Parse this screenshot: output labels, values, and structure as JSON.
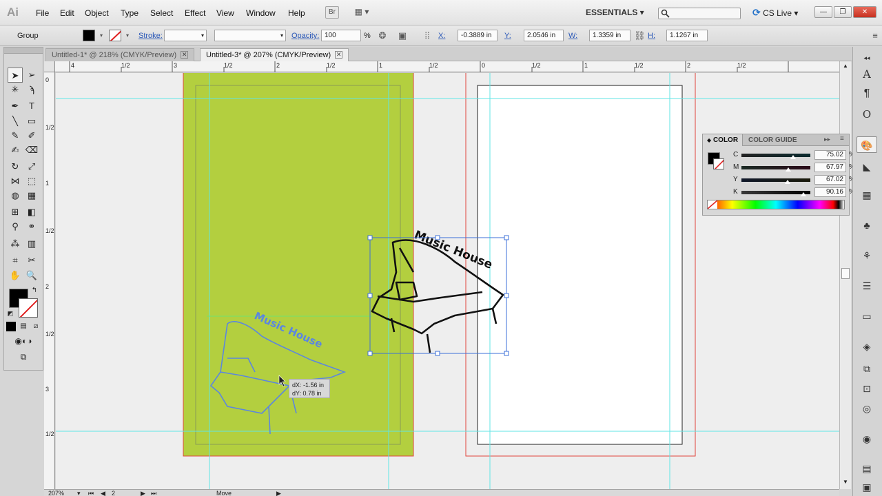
{
  "app": {
    "logo": "Ai"
  },
  "menu": [
    "File",
    "Edit",
    "Object",
    "Type",
    "Select",
    "Effect",
    "View",
    "Window",
    "Help"
  ],
  "menubar": {
    "bridge_label": "Br",
    "arrange_label": "▦ ▾",
    "workspace": "ESSENTIALS ▾",
    "search_placeholder": "",
    "cslive": "CS Live ▾",
    "win_min": "—",
    "win_max": "❐",
    "win_close": "✕"
  },
  "control": {
    "selection_type": "Group",
    "stroke_label": "Stroke:",
    "opacity_label": "Opacity:",
    "opacity_value": "100",
    "opacity_unit": "%",
    "x_label": "X:",
    "x_value": "-0.3889 in",
    "y_label": "Y:",
    "y_value": "2.0546 in",
    "w_label": "W:",
    "w_value": "1.3359 in",
    "h_label": "H:",
    "h_value": "1.1267 in"
  },
  "tabs": [
    {
      "label": "Untitled-1* @ 218% (CMYK/Preview)",
      "active": false
    },
    {
      "label": "Untitled-3* @ 207% (CMYK/Preview)",
      "active": true
    }
  ],
  "ruler_top": [
    "4",
    "1/2",
    "3",
    "1/2",
    "2",
    "1/2",
    "1",
    "1/2",
    "0",
    "1/2",
    "1",
    "1/2",
    "2",
    "1/2"
  ],
  "ruler_left": [
    "0",
    "1/2",
    "1",
    "1/2",
    "2",
    "1/2",
    "3",
    "1/2"
  ],
  "artwork": {
    "logo_text": "Music House",
    "move_tooltip": {
      "dx": "dX: -1.56 in",
      "dy": "dY: 0.78 in"
    },
    "colors": {
      "artboard_fill": "#b3cf3f",
      "bleed_red": "#e0443c",
      "guide_cyan": "#5fe6e6",
      "selection_blue": "#3b6fd8",
      "ghost_blue": "#5b86e0"
    }
  },
  "color_panel": {
    "tab_color": "COLOR",
    "tab_guide": "COLOR GUIDE",
    "channels": [
      {
        "letter": "C",
        "value": "75.02",
        "unit": "%"
      },
      {
        "letter": "M",
        "value": "67.97",
        "unit": "%"
      },
      {
        "letter": "Y",
        "value": "67.02",
        "unit": "%"
      },
      {
        "letter": "K",
        "value": "90.16",
        "unit": "%"
      }
    ]
  },
  "status": {
    "zoom": "207%",
    "artboard_num": "2",
    "tool_status": "Move"
  }
}
